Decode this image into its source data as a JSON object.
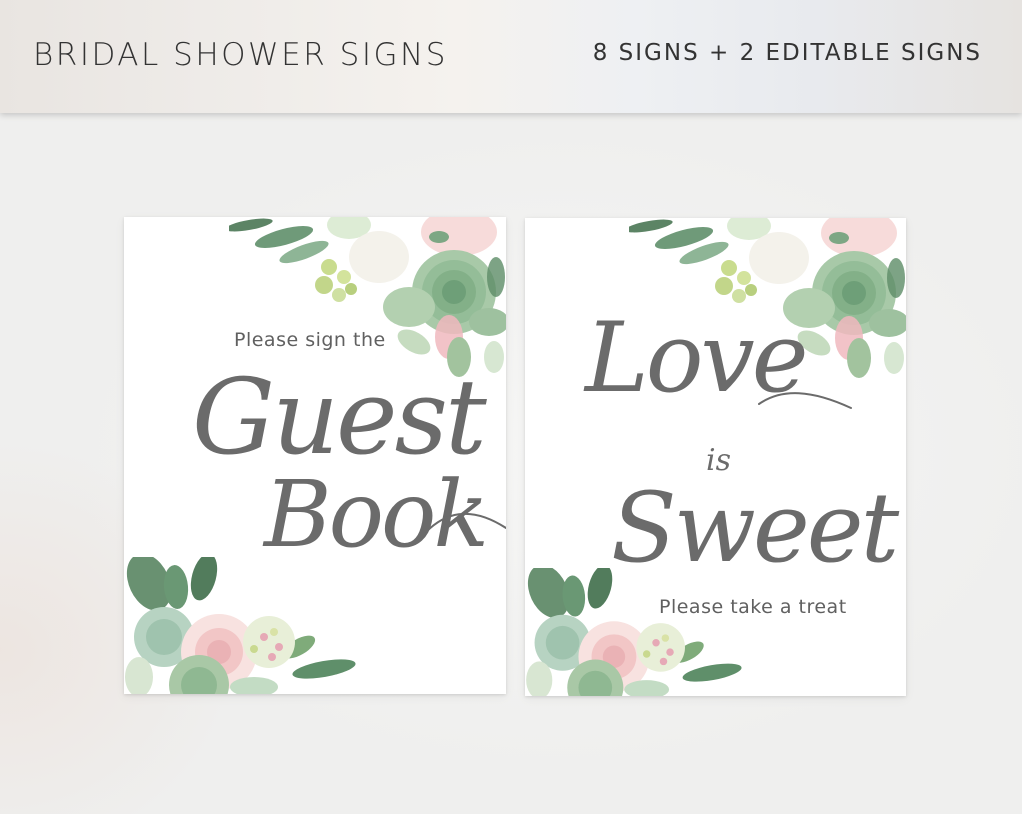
{
  "banner": {
    "title": "BRIDAL SHOWER SIGNS",
    "subtitle": "8 SIGNS + 2 EDITABLE SIGNS"
  },
  "signs": [
    {
      "intro": "Please sign the",
      "word1": "Guest",
      "word2": "Book"
    },
    {
      "word1": "Love",
      "connector": "is",
      "word2": "Sweet",
      "caption": "Please take a treat"
    }
  ],
  "colors": {
    "text": "#6b6b6b",
    "leaf_green": "#6f9e79",
    "succulent": "#9cc39f",
    "blush": "#f3c9c9",
    "lime": "#c8dc8e"
  },
  "icons": [
    "floral-succulent-corner",
    "floral-bouquet-corner"
  ]
}
